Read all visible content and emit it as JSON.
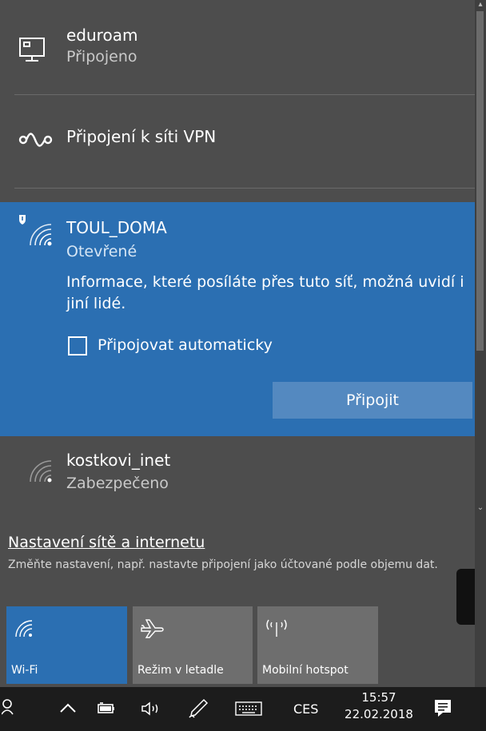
{
  "networks": [
    {
      "name": "eduroam",
      "status": "Připojeno",
      "icon": "ethernet-icon"
    },
    {
      "name": "Připojení k síti VPN",
      "icon": "vpn-icon"
    },
    {
      "name": "TOUL_DOMA",
      "status": "Otevřené",
      "icon": "wifi-open-icon",
      "info": "Informace, které posíláte přes tuto síť, možná uvidí i jiní lidé.",
      "auto_connect_label": "Připojovat automaticky",
      "connect_label": "Připojit"
    },
    {
      "name": "kostkovi_inet",
      "status": "Zabezpečeno",
      "icon": "wifi-secured-icon"
    }
  ],
  "settings": {
    "link": "Nastavení sítě a internetu",
    "description": "Změňte nastavení, např. nastavte připojení jako účtované podle objemu dat."
  },
  "quick_actions": [
    {
      "label": "Wi-Fi",
      "icon": "wifi-icon",
      "active": true
    },
    {
      "label": "Režim v letadle",
      "icon": "airplane-icon",
      "active": false
    },
    {
      "label": "Mobilní hotspot",
      "icon": "hotspot-icon",
      "active": false
    }
  ],
  "taskbar": {
    "language": "CES",
    "time": "15:57",
    "date": "22.02.2018"
  },
  "colors": {
    "accent": "#2b6fb2",
    "flyout_bg": "#4d4d4d",
    "tile_bg": "#6e6e6e",
    "taskbar_bg": "#1c1c1c"
  }
}
